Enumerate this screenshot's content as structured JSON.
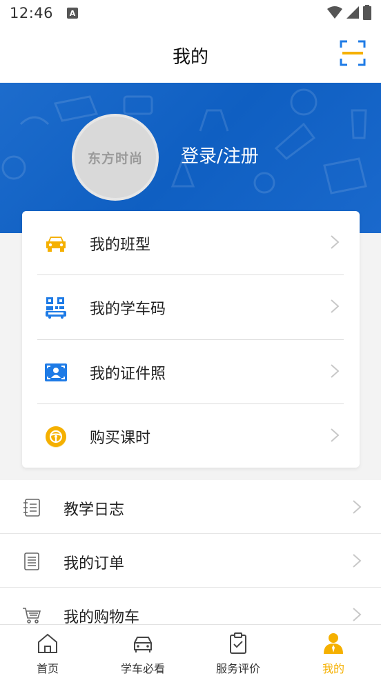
{
  "status_bar": {
    "time": "12:46",
    "notification": "A"
  },
  "header": {
    "title": "我的"
  },
  "profile": {
    "login_text": "登录/注册",
    "avatar_text": "东方时尚"
  },
  "card_menu": [
    {
      "label": "我的班型",
      "icon": "car-icon"
    },
    {
      "label": "我的学车码",
      "icon": "qr-code-icon"
    },
    {
      "label": "我的证件照",
      "icon": "id-photo-icon"
    },
    {
      "label": "购买课时",
      "icon": "steering-wheel-icon"
    }
  ],
  "list_menu": [
    {
      "label": "教学日志",
      "icon": "notebook-icon"
    },
    {
      "label": "我的订单",
      "icon": "order-icon"
    },
    {
      "label": "我的购物车",
      "icon": "cart-icon"
    }
  ],
  "tabbar": [
    {
      "label": "首页",
      "icon": "home-icon"
    },
    {
      "label": "学车必看",
      "icon": "car-outline-icon"
    },
    {
      "label": "服务评价",
      "icon": "clipboard-check-icon"
    },
    {
      "label": "我的",
      "icon": "person-icon",
      "active": true
    }
  ],
  "colors": {
    "accent": "#f5b000",
    "banner": "#1266c8",
    "icon_blue": "#1e7be6"
  }
}
